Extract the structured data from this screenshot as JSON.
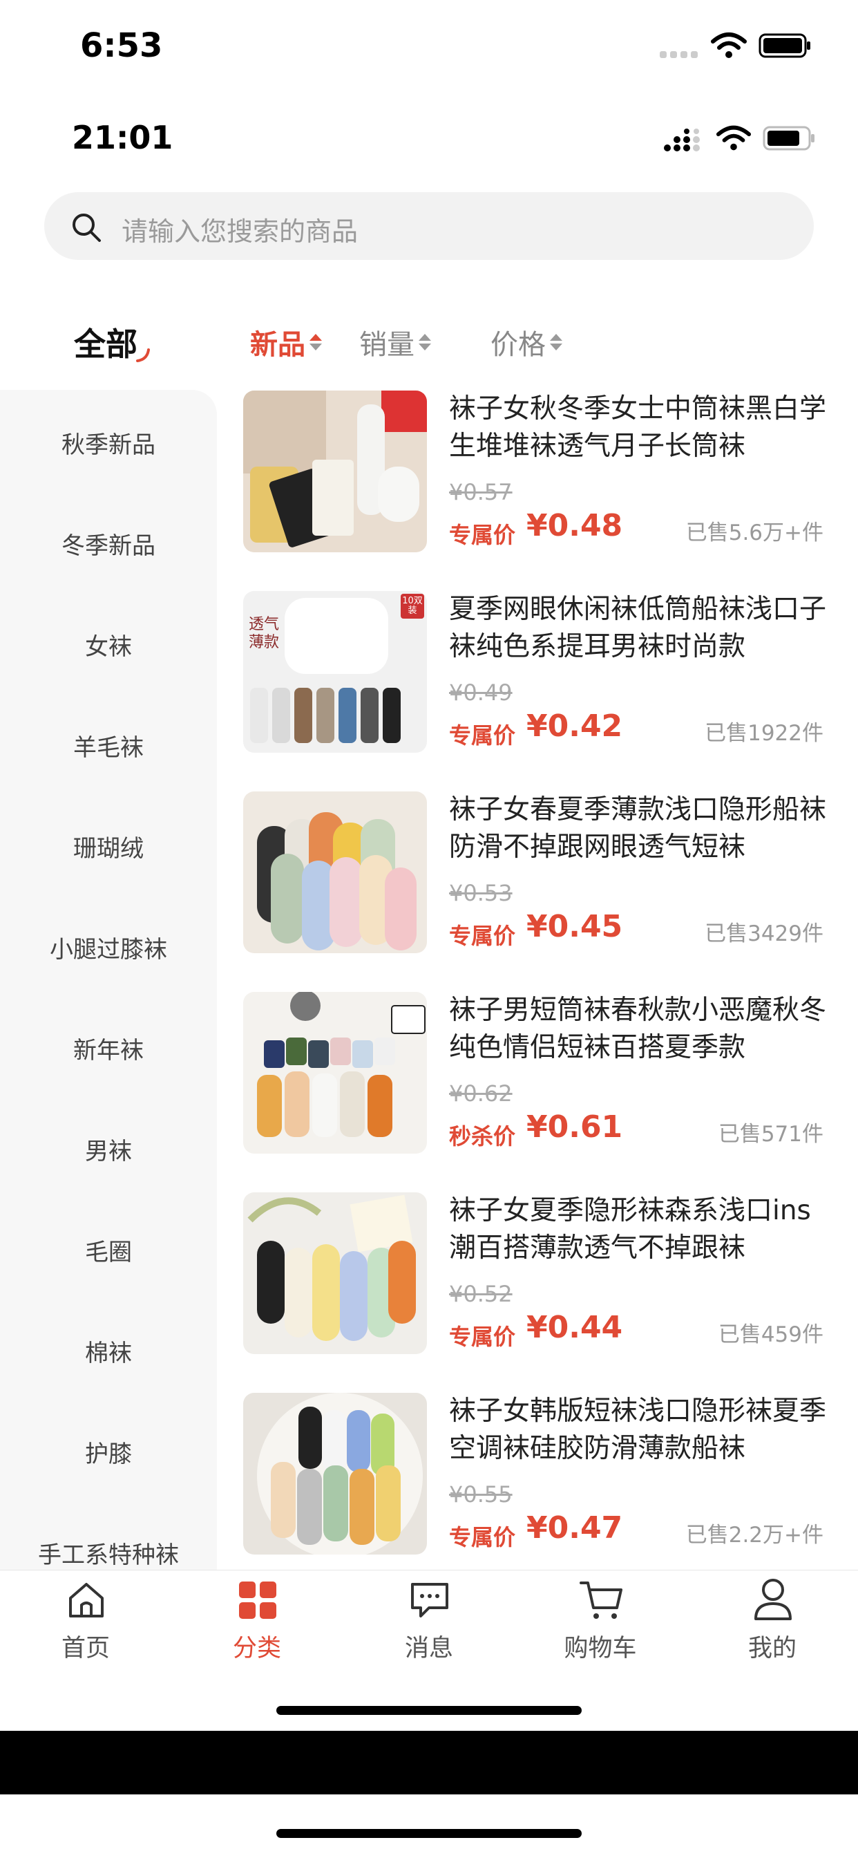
{
  "status_outer": {
    "time": "6:53"
  },
  "status_inner": {
    "time": "21:01"
  },
  "search": {
    "placeholder": "请输入您搜索的商品"
  },
  "category_header": {
    "label": "全部"
  },
  "sort_tabs": [
    {
      "label": "新品",
      "active": true
    },
    {
      "label": "销量",
      "active": false
    },
    {
      "label": "价格",
      "active": false
    }
  ],
  "sidebar": {
    "items": [
      "秋季新品",
      "冬季新品",
      "女袜",
      "羊毛袜",
      "珊瑚绒",
      "小腿过膝袜",
      "新年袜",
      "男袜",
      "毛圈",
      "棉袜",
      "护膝",
      "手工系特种袜"
    ]
  },
  "products": [
    {
      "title": "袜子女秋冬季女士中筒袜黑白学生堆堆袜透气月子长筒袜",
      "old_price": "¥0.57",
      "tag": "专属价",
      "price": "¥0.48",
      "sold": "已售5.6万+件"
    },
    {
      "title": "夏季网眼休闲袜低筒船袜浅口子袜纯色系提耳男袜时尚款",
      "old_price": "¥0.49",
      "tag": "专属价",
      "price": "¥0.42",
      "sold": "已售1922件",
      "badge": "10双装",
      "overlay": "透气薄款"
    },
    {
      "title": "袜子女春夏季薄款浅口隐形船袜防滑不掉跟网眼透气短袜",
      "old_price": "¥0.53",
      "tag": "专属价",
      "price": "¥0.45",
      "sold": "已售3429件"
    },
    {
      "title": "袜子男短筒袜春秋款小恶魔秋冬纯色情侣短袜百搭夏季款",
      "old_price": "¥0.62",
      "tag": "秒杀价",
      "price": "¥0.61",
      "sold": "已售571件"
    },
    {
      "title": "袜子女夏季隐形袜森系浅口ins潮百搭薄款透气不掉跟袜",
      "old_price": "¥0.52",
      "tag": "专属价",
      "price": "¥0.44",
      "sold": "已售459件"
    },
    {
      "title": "袜子女韩版短袜浅口隐形袜夏季空调袜硅胶防滑薄款船袜",
      "old_price": "¥0.55",
      "tag": "专属价",
      "price": "¥0.47",
      "sold": "已售2.2万+件"
    }
  ],
  "tabbar": {
    "items": [
      {
        "label": "首页",
        "icon": "home-icon",
        "active": false
      },
      {
        "label": "分类",
        "icon": "category-grid-icon",
        "active": true
      },
      {
        "label": "消息",
        "icon": "message-icon",
        "active": false
      },
      {
        "label": "购物车",
        "icon": "cart-icon",
        "active": false
      },
      {
        "label": "我的",
        "icon": "user-icon",
        "active": false
      }
    ]
  },
  "colors": {
    "accent": "#e04a35",
    "sidebar_bg": "#f7f7f7",
    "search_bg": "#f2f2f2"
  }
}
